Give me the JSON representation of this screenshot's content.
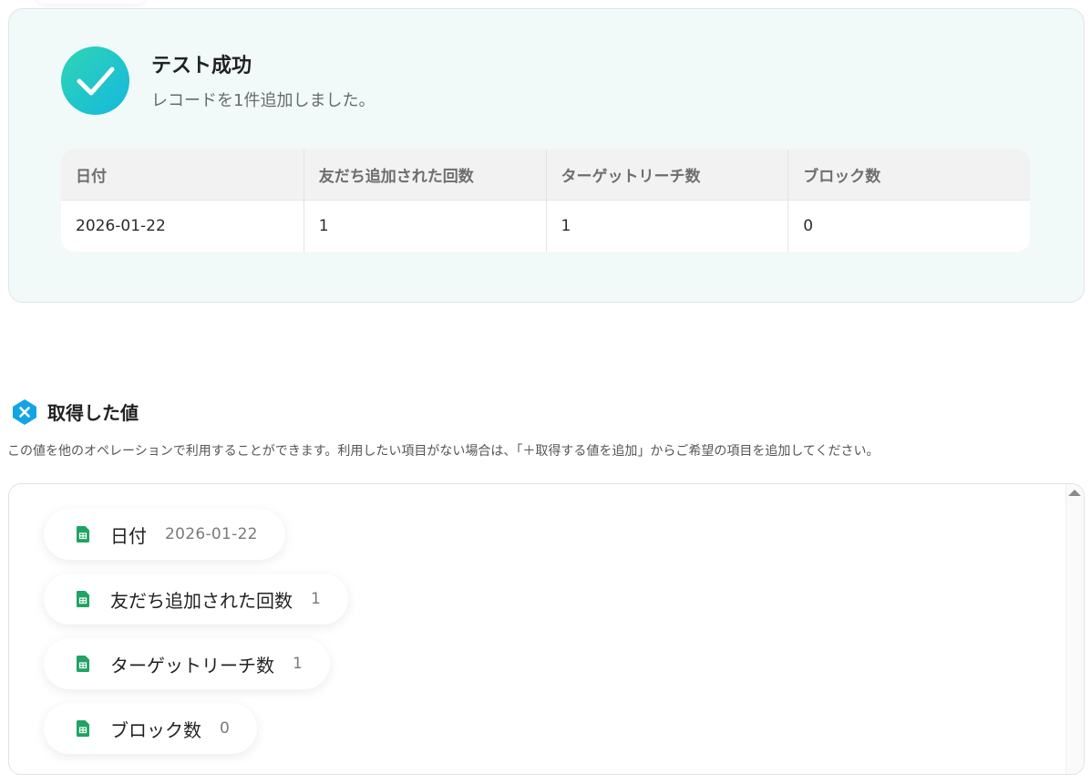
{
  "result": {
    "title": "テスト成功",
    "subtitle": "レコードを1件追加しました。",
    "table": {
      "headers": [
        "日付",
        "友だち追加された回数",
        "ターゲットリーチ数",
        "ブロック数"
      ],
      "rows": [
        [
          "2026-01-22",
          "1",
          "1",
          "0"
        ]
      ]
    }
  },
  "acquired": {
    "title": "取得した値",
    "description": "この値を他のオペレーションで利用することができます。利用したい項目がない場合は、「＋取得する値を追加」からご希望の項目を追加してください。",
    "items": [
      {
        "label": "日付",
        "value": "2026-01-22",
        "icon": "google-sheets-icon"
      },
      {
        "label": "友だち追加された回数",
        "value": "1",
        "icon": "google-sheets-icon"
      },
      {
        "label": "ターゲットリーチ数",
        "value": "1",
        "icon": "google-sheets-icon"
      },
      {
        "label": "ブロック数",
        "value": "0",
        "icon": "google-sheets-icon"
      }
    ]
  },
  "colors": {
    "success_gradient_start": "#2fd5b5",
    "success_gradient_end": "#14b8de",
    "sheets_green": "#1fa463",
    "panel_bg": "#f1faf9"
  }
}
